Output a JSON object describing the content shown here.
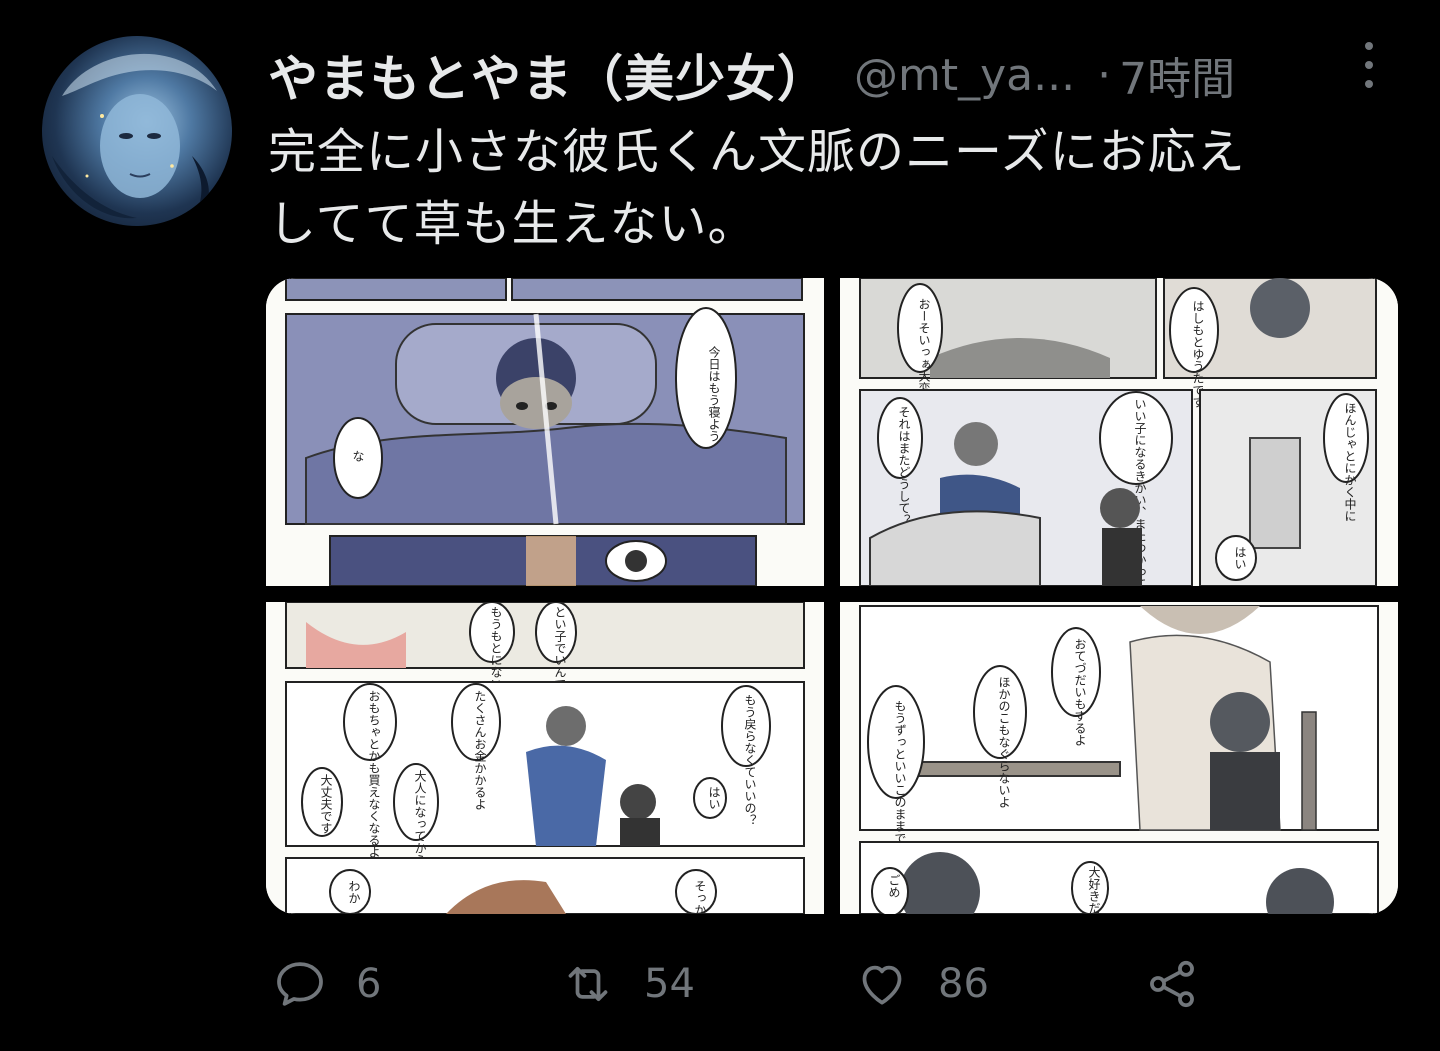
{
  "tweet": {
    "display_name": "やまもとやま（美少女）",
    "handle": "@mt_ya...",
    "separator": "·",
    "time": "7時間",
    "text_line1": "完全に小さな彼氏くん文脈のニーズにお応え",
    "text_line2": "してて草も生えない。"
  },
  "media": {
    "panels": [
      {
        "name": "manga-page-1",
        "bubbles": [
          "今日はもう寝よう",
          "な"
        ]
      },
      {
        "name": "manga-page-2",
        "bubbles": [
          "おーそいっぁ大変だ",
          "はしもとゆうたです",
          "いい子になるきかい、またつかってください",
          "それはまたどうして？",
          "ほんじゃとにかく中に",
          "はい"
        ]
      },
      {
        "name": "manga-page-3",
        "bubbles": [
          "もうもとにないようにください",
          "とい子でいんです",
          "もう戻らなくていいの？",
          "たくさんお金かかるよ",
          "おもちゃとかも買えなくなるよ",
          "大人になってから払います",
          "はい",
          "大丈夫です",
          "わか",
          "そっか"
        ]
      },
      {
        "name": "manga-page-4",
        "bubbles": [
          "おてづだいもするよ",
          "ほかのこもなぐらないよ",
          "もうずっといいこのままでいるよ",
          "ごめ",
          "大好きだ愛してる"
        ]
      }
    ]
  },
  "actions": {
    "reply_count": "6",
    "retweet_count": "54",
    "like_count": "86"
  },
  "icons": {
    "reply": "reply-icon",
    "retweet": "retweet-icon",
    "like": "heart-icon",
    "share": "share-icon",
    "more": "more-vertical-icon"
  },
  "colors": {
    "background": "#000000",
    "text": "#e7e9ea",
    "secondary": "#71767b"
  }
}
